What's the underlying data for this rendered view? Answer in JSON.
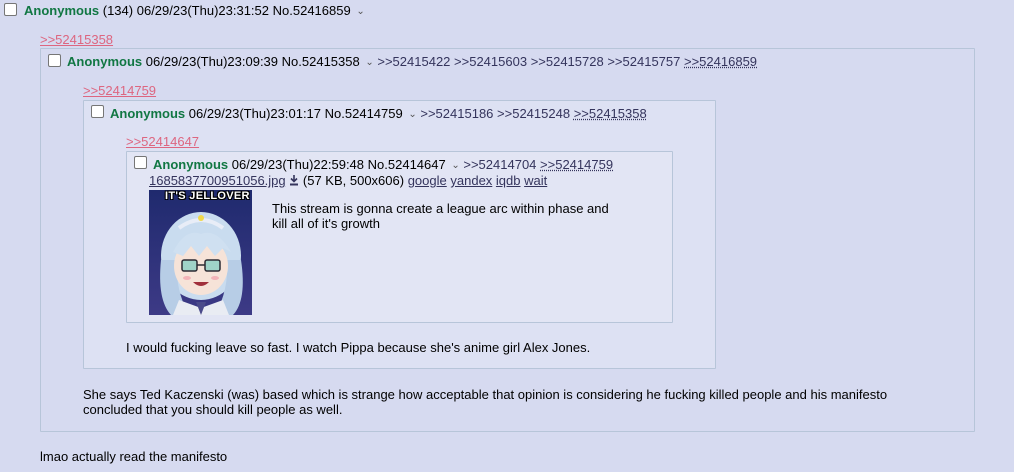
{
  "post_main": {
    "name": "Anonymous",
    "id_count": "(134)",
    "datetime": "06/29/23(Thu)23:31:52",
    "number": "No.52416859",
    "message": "lmao actually read the manifesto"
  },
  "quote_link_1": ">>52415358",
  "post_a": {
    "name": "Anonymous",
    "datetime": "06/29/23(Thu)23:09:39",
    "number": "No.52415358",
    "replies": [
      ">>52415422",
      ">>52415603",
      ">>52415728",
      ">>52415757",
      ">>52416859"
    ],
    "message_lines": [
      "She says Ted Kaczenski (was) based which is strange how acceptable that opinion is considering he fucking killed people and his manifesto",
      "concluded that you should kill people as well."
    ]
  },
  "quote_link_2": ">>52414759",
  "post_b": {
    "name": "Anonymous",
    "datetime": "06/29/23(Thu)23:01:17",
    "number": "No.52414759",
    "replies": [
      ">>52415186",
      ">>52415248",
      ">>52415358"
    ],
    "message": "I would fucking leave so fast. I watch Pippa because she's anime girl Alex Jones."
  },
  "quote_link_3": ">>52414647",
  "post_c": {
    "name": "Anonymous",
    "datetime": "06/29/23(Thu)22:59:48",
    "number": "No.52414647",
    "replies": [
      ">>52414704",
      ">>52414759"
    ],
    "file": {
      "filename": "1685837700951056.jpg",
      "meta": "(57 KB, 500x606)",
      "links": [
        "google",
        "yandex",
        "iqdb",
        "wait"
      ]
    },
    "thumb_caption": "IT'S JELLOVER",
    "message_lines": [
      "This stream is gonna create a league arc within phase and",
      "kill all of it's growth"
    ]
  },
  "colors": {
    "background": "#d6daf0",
    "name": "#117743",
    "quotelink": "#34345c",
    "backlink": "#dd6680",
    "border": "#b7c5d9"
  }
}
